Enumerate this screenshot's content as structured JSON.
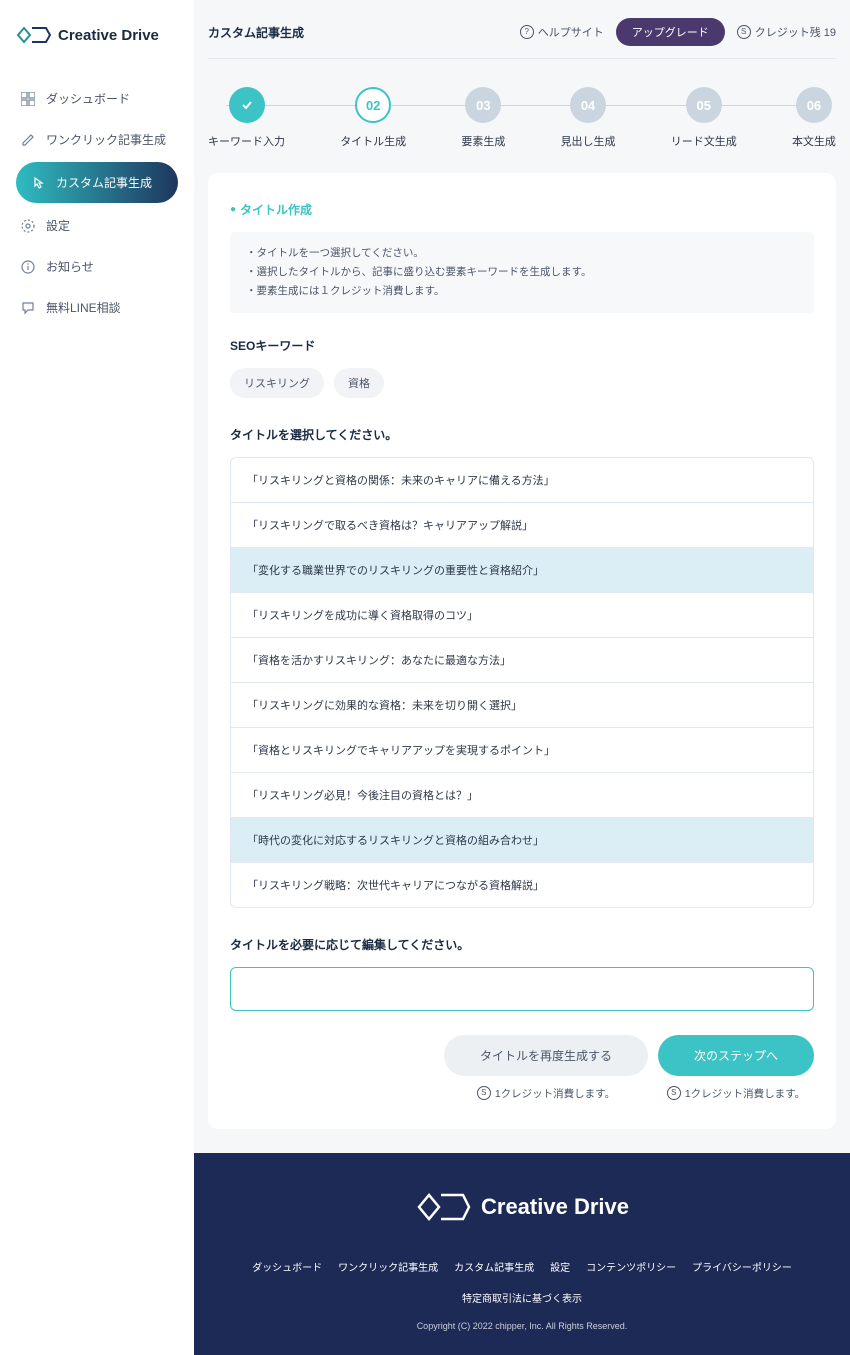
{
  "brand": "Creative Drive",
  "sidebar": {
    "items": [
      {
        "label": "ダッシュボード"
      },
      {
        "label": "ワンクリック記事生成"
      },
      {
        "label": "カスタム記事生成"
      },
      {
        "label": "設定"
      },
      {
        "label": "お知らせ"
      },
      {
        "label": "無料LINE相談"
      }
    ]
  },
  "header": {
    "title": "カスタム記事生成",
    "help": "ヘルプサイト",
    "upgrade": "アップグレード",
    "credit_label": "クレジット残 19"
  },
  "steps": [
    {
      "num": "✓",
      "label": "キーワード入力"
    },
    {
      "num": "02",
      "label": "タイトル生成"
    },
    {
      "num": "03",
      "label": "要素生成"
    },
    {
      "num": "04",
      "label": "見出し生成"
    },
    {
      "num": "05",
      "label": "リード文生成"
    },
    {
      "num": "06",
      "label": "本文生成"
    }
  ],
  "section": {
    "heading": "タイトル作成",
    "bullet1": "・タイトルを一つ選択してください。",
    "bullet2": "・選択したタイトルから、記事に盛り込む要素キーワードを生成します。",
    "bullet3": "・要素生成には１クレジット消費します。"
  },
  "seo": {
    "label": "SEOキーワード",
    "tags": [
      "リスキリング",
      "資格"
    ]
  },
  "titles": {
    "label": "タイトルを選択してください。",
    "items": [
      "「リスキリングと資格の関係：未来のキャリアに備える方法」",
      "「リスキリングで取るべき資格は？キャリアアップ解説」",
      "「変化する職業世界でのリスキリングの重要性と資格紹介」",
      "「リスキリングを成功に導く資格取得のコツ」",
      "「資格を活かすリスキリング：あなたに最適な方法」",
      "「リスキリングに効果的な資格：未来を切り開く選択」",
      "「資格とリスキリングでキャリアアップを実現するポイント」",
      "「リスキリング必見！今後注目の資格とは？」",
      "「時代の変化に対応するリスキリングと資格の組み合わせ」",
      "「リスキリング戦略：次世代キャリアにつながる資格解説」"
    ]
  },
  "edit": {
    "label": "タイトルを必要に応じて編集してください。",
    "value": ""
  },
  "actions": {
    "regenerate": "タイトルを再度生成する",
    "next": "次のステップへ",
    "credit_note": "1クレジット消費します。"
  },
  "footer": {
    "links": [
      "ダッシュボード",
      "ワンクリック記事生成",
      "カスタム記事生成",
      "設定",
      "コンテンツポリシー",
      "プライバシーポリシー",
      "特定商取引法に基づく表示"
    ],
    "copyright": "Copyright (C) 2022 chipper, Inc. All Rights Reserved."
  }
}
